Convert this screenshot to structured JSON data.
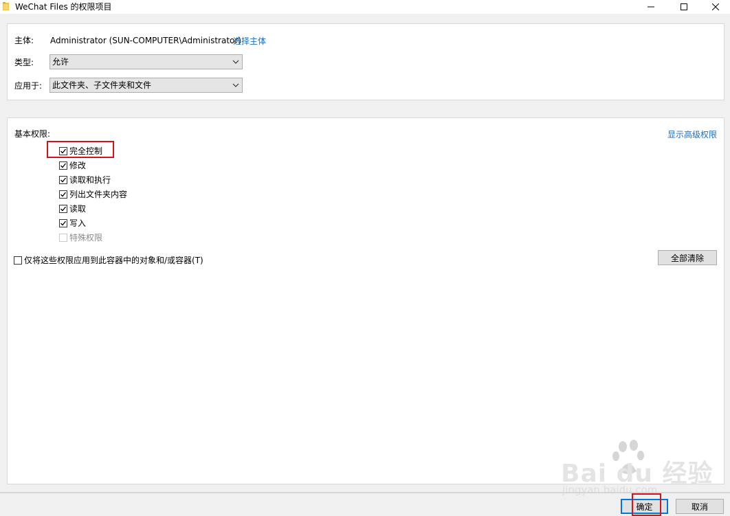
{
  "window": {
    "title": "WeChat Files 的权限项目",
    "controls": {
      "minimize": "minimize",
      "maximize": "maximize",
      "close": "close"
    }
  },
  "principal": {
    "label": "主体:",
    "value": "Administrator (SUN-COMPUTER\\Administrator)",
    "select_link": "选择主体"
  },
  "type": {
    "label": "类型:",
    "selected": "允许"
  },
  "applies_to": {
    "label": "应用于:",
    "selected": "此文件夹、子文件夹和文件"
  },
  "permissions": {
    "heading": "基本权限:",
    "advanced_link": "显示高级权限",
    "items": [
      {
        "label": "完全控制",
        "checked": true,
        "enabled": true
      },
      {
        "label": "修改",
        "checked": true,
        "enabled": true
      },
      {
        "label": "读取和执行",
        "checked": true,
        "enabled": true
      },
      {
        "label": "列出文件夹内容",
        "checked": true,
        "enabled": true
      },
      {
        "label": "读取",
        "checked": true,
        "enabled": true
      },
      {
        "label": "写入",
        "checked": true,
        "enabled": true
      },
      {
        "label": "特殊权限",
        "checked": false,
        "enabled": false
      }
    ],
    "apply_only_label": "仅将这些权限应用到此容器中的对象和/或容器(T)",
    "apply_only_checked": false,
    "clear_all_button": "全部清除"
  },
  "footer": {
    "ok_button": "确定",
    "cancel_button": "取消"
  },
  "watermark": {
    "brand": "Bai du 经验",
    "url": "jingyan.baidu.com"
  },
  "colors": {
    "link": "#1c6fb5",
    "highlight": "#d51219",
    "default_button_border": "#0078d7"
  }
}
